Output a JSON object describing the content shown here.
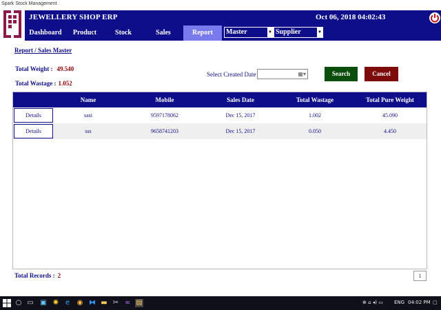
{
  "window": {
    "title": "Spark Stock Management"
  },
  "app": {
    "title": "JEWELLERY SHOP ERP",
    "datetime": "Oct 06, 2018 04:02:43"
  },
  "nav": {
    "items": [
      {
        "label": "Dashboard"
      },
      {
        "label": "Product"
      },
      {
        "label": "Stock"
      },
      {
        "label": "Sales"
      },
      {
        "label": "Report"
      }
    ],
    "selects": [
      {
        "value": "Master"
      },
      {
        "value": "Supplier"
      }
    ]
  },
  "breadcrumb": "Report / Sales Master",
  "summary": {
    "total_weight_label": "Total Weight :",
    "total_weight": "49.540",
    "total_wastage_label": "Total Wastage :",
    "total_wastage": "1.052"
  },
  "filter": {
    "date_label": "Select Created Date",
    "date_value": "",
    "search_label": "Search",
    "cancel_label": "Cancel"
  },
  "table": {
    "headers": [
      "Name",
      "Mobile",
      "Sales Date",
      "Total Wastage",
      "Total Pure Weight"
    ],
    "rows": [
      {
        "action": "Details",
        "name": "sasi",
        "mobile": "9597178062",
        "date": "Dec 15, 2017",
        "wastage": "1.002",
        "weight": "45.090"
      },
      {
        "action": "Details",
        "name": "sss",
        "mobile": "9658741203",
        "date": "Dec 15, 2017",
        "wastage": "0.050",
        "weight": "4.450"
      }
    ]
  },
  "footer": {
    "total_records_label": "Total Records :",
    "total_records": "2",
    "page": "1"
  },
  "taskbar": {
    "lang": "ENG",
    "time": "04:02 PM"
  },
  "colors": {
    "primary": "#0e0e8a",
    "active_nav": "#7a7aef",
    "search": "#0b4d0b",
    "cancel": "#7d0b0b",
    "value": "#8b0000",
    "logo": "#8b1a4a"
  }
}
